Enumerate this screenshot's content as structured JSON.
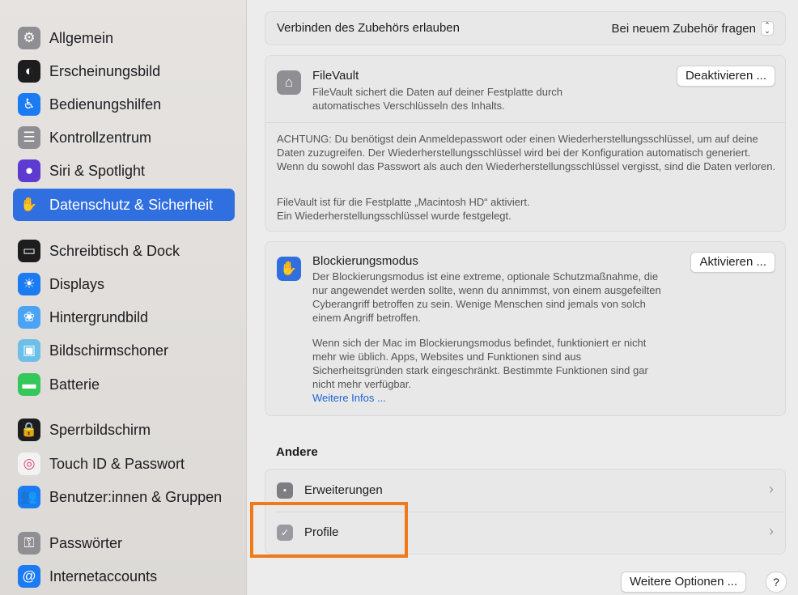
{
  "sidebar": {
    "items": [
      {
        "label": "Allgemein",
        "icon": "gear-icon",
        "color": "#8e8e93",
        "glyph": "⚙"
      },
      {
        "label": "Erscheinungsbild",
        "icon": "appearance-icon",
        "color": "#1d1d1f",
        "glyph": "◐"
      },
      {
        "label": "Bedienungshilfen",
        "icon": "accessibility-icon",
        "color": "#1a7bf2",
        "glyph": "♿"
      },
      {
        "label": "Kontrollzentrum",
        "icon": "control-center-icon",
        "color": "#8e8e93",
        "glyph": "☰"
      },
      {
        "label": "Siri & Spotlight",
        "icon": "siri-icon",
        "color": "#5e3bd0",
        "glyph": "●"
      },
      {
        "label": "Datenschutz & Sicherheit",
        "icon": "hand-icon",
        "color": "#2f6fe0",
        "glyph": "✋"
      },
      {
        "label": "Schreibtisch & Dock",
        "icon": "desktop-dock-icon",
        "color": "#1d1d1f",
        "glyph": "▭"
      },
      {
        "label": "Displays",
        "icon": "sun-icon",
        "color": "#1a7bf2",
        "glyph": "☀"
      },
      {
        "label": "Hintergrundbild",
        "icon": "wallpaper-icon",
        "color": "#4aa3f5",
        "glyph": "❀"
      },
      {
        "label": "Bildschirmschoner",
        "icon": "screensaver-icon",
        "color": "#6cc0e8",
        "glyph": "▣"
      },
      {
        "label": "Batterie",
        "icon": "battery-icon",
        "color": "#34c759",
        "glyph": "▬"
      },
      {
        "label": "Sperrbildschirm",
        "icon": "lock-icon",
        "color": "#1d1d1f",
        "glyph": "🔒"
      },
      {
        "label": "Touch ID & Passwort",
        "icon": "fingerprint-icon",
        "color": "#f2f2f2",
        "glyph": "◎"
      },
      {
        "label": "Benutzer:innen & Gruppen",
        "icon": "users-icon",
        "color": "#1a7bf2",
        "glyph": "👥"
      },
      {
        "label": "Passwörter",
        "icon": "key-icon",
        "color": "#8e8e93",
        "glyph": "⚿"
      },
      {
        "label": "Internetaccounts",
        "icon": "at-icon",
        "color": "#1a7bf2",
        "glyph": "@"
      }
    ],
    "active_index": 5
  },
  "accessory": {
    "label": "Verbinden des Zubehörs erlauben",
    "value": "Bei neuem Zubehör fragen"
  },
  "filevault": {
    "title": "FileVault",
    "desc1": "FileVault sichert die Daten auf deiner Festplatte durch",
    "desc2": "automatisches Verschlüsseln des Inhalts.",
    "button": "Deaktivieren ...",
    "warning": "ACHTUNG: Du benötigst dein Anmeldepasswort oder einen Wiederherstellungsschlüssel, um auf deine Daten zuzugreifen. Der Wiederherstellungsschlüssel wird bei der Konfiguration automatisch generiert. Wenn du sowohl das Passwort als auch den Wiederherstellungsschlüssel vergisst, sind die Daten verloren.",
    "status1": "FileVault ist für die Festplatte „Macintosh HD“ aktiviert.",
    "status2": "Ein Wiederherstellungsschlüssel wurde festgelegt."
  },
  "lockdown": {
    "title": "Blockierungsmodus",
    "button": "Aktivieren ...",
    "desc1": "Der Blockierungsmodus ist eine extreme, optionale Schutzmaßnahme, die nur angewendet werden sollte, wenn du annimmst, von einem ausgefeilten Cyberangriff betroffen zu sein. Wenige Menschen sind jemals von solch einem Angriff betroffen.",
    "desc2": "Wenn sich der Mac im Blockierungsmodus befindet, funktioniert er nicht mehr wie üblich. Apps, Websites und Funktionen sind aus Sicherheitsgründen stark eingeschränkt. Bestimmte Funktionen sind gar nicht mehr verfügbar.",
    "link": "Weitere Infos ..."
  },
  "other": {
    "heading": "Andere",
    "rows": [
      {
        "label": "Erweiterungen",
        "icon": "extensions-icon"
      },
      {
        "label": "Profile",
        "icon": "profile-check-icon"
      }
    ]
  },
  "footer": {
    "more_options": "Weitere Optionen ...",
    "help": "?"
  },
  "highlight_color": "#f07a1a"
}
